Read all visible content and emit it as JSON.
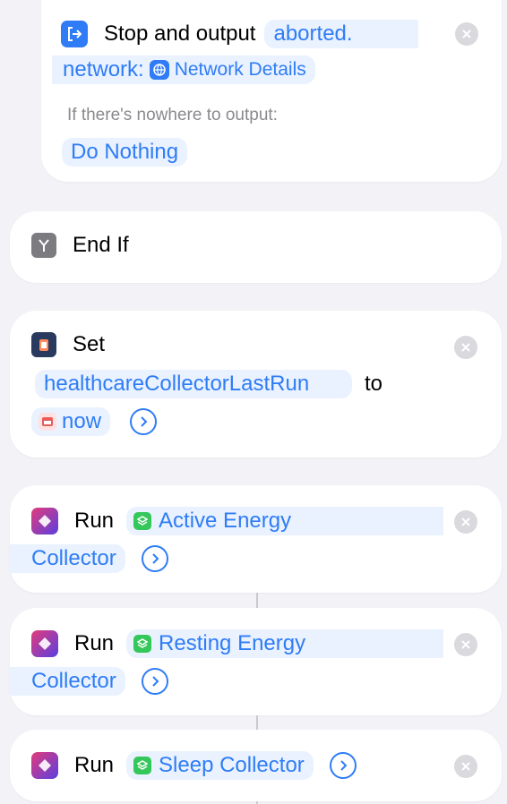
{
  "stop_card": {
    "label": "Stop and output",
    "token_line1": "aborted.",
    "token_line2_prefix": "network:",
    "network_token": "Network Details",
    "nowhere_label": "If there's nowhere to output:",
    "nowhere_value": "Do Nothing",
    "icon": "exit-icon"
  },
  "end_if": {
    "label": "End If",
    "icon": "branch-icon"
  },
  "set_card": {
    "label": "Set",
    "variable": "healthcareCollectorLastRun",
    "to_label": "to",
    "value": "now",
    "icon": "database-icon"
  },
  "run_cards": [
    {
      "label": "Run",
      "shortcut_line1": "Active Energy",
      "shortcut_line2": "Collector"
    },
    {
      "label": "Run",
      "shortcut_line1": "Resting Energy",
      "shortcut_line2": "Collector"
    },
    {
      "label": "Run",
      "shortcut_line1": "Sleep Collector"
    }
  ],
  "colors": {
    "accent": "#2f7cf6",
    "token_bg": "#e9f2fe",
    "background": "#f2f2f7",
    "shortcut_green": "#34c759"
  }
}
